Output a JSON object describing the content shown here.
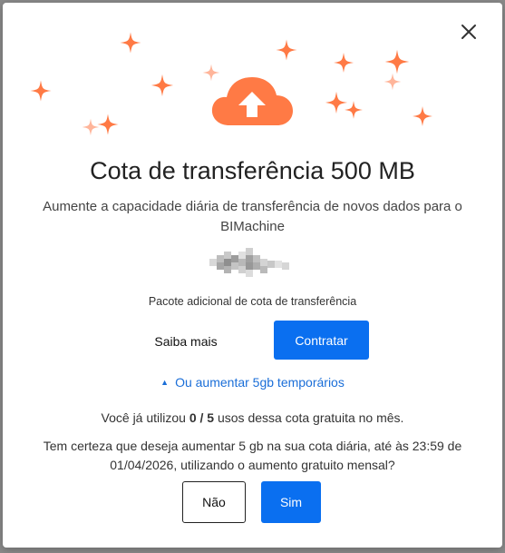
{
  "modal": {
    "title": "Cota de transferência 500 MB",
    "subtitle": "Aumente a capacidade diária de transferência de novos dados para o BIMachine",
    "package_label": "Pacote adicional de cota de transferência",
    "learn_more_label": "Saiba mais",
    "contract_label": "Contratar",
    "toggle_label": "Ou aumentar 5gb temporários",
    "usage": {
      "prefix": "Você já utilizou ",
      "used": "0 / 5",
      "suffix": " usos dessa cota gratuita no mês."
    },
    "confirm_text": "Tem certeza que deseja aumentar 5 gb na sua cota diária, até às 23:59 de 01/04/2026, utilizando o aumento gratuito mensal?",
    "no_label": "Não",
    "yes_label": "Sim"
  },
  "icons": {
    "close": "close-icon",
    "cloud_upload": "cloud-upload-icon",
    "sparkles": "sparkle-icon",
    "toggle_caret": "caret-up-icon"
  },
  "colors": {
    "accent_orange": "#ff7a45",
    "light_orange": "#ffb59a",
    "primary_blue": "#0a6ff0",
    "link_blue": "#1a6ed8"
  }
}
